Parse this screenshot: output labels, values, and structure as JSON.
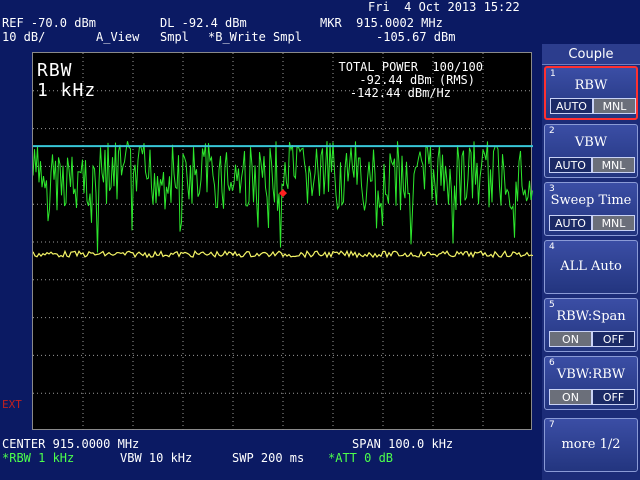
{
  "status_bar": {
    "datetime": "Fri  4 Oct 2013 15:22"
  },
  "header": {
    "ref": "REF -70.0 dBm",
    "dl": "DL -92.4 dBm",
    "mkr": "MKR  915.0002 MHz",
    "scale": "10 dB/",
    "a_view": "A_View",
    "smpl1": "Smpl",
    "b_write": "*B_Write Smpl",
    "mkr_level": "-105.67 dBm"
  },
  "display": {
    "rbw_label": "RBW",
    "rbw_value": "1 kHz",
    "total_power_title": "TOTAL POWER  100/100",
    "total_power_rms": "-92.44 dBm (RMS)",
    "total_power_density": "-142.44 dBm/Hz",
    "ext": "EXT",
    "display_line_div": 2.2,
    "trace_a_level_div": 3.1,
    "trace_b_level_div": 2.2,
    "marker_level_div": 3.6,
    "colors": {
      "trace_a": "#f4f466",
      "trace_b": "#2de62d",
      "display_line": "#38c7d8",
      "marker": "#ff2020",
      "grid": "#9a9a9a"
    }
  },
  "footer": {
    "center": "CENTER 915.0000 MHz",
    "span": "SPAN 100.0 kHz",
    "rbw": "*RBW 1 kHz",
    "vbw": "VBW 10 kHz",
    "swp": "SWP 200 ms",
    "att": "*ATT 0 dB"
  },
  "menu": {
    "title": "Couple",
    "keys": [
      {
        "num": "1",
        "label": "RBW",
        "on": "AUTO",
        "off": "MNL"
      },
      {
        "num": "2",
        "label": "VBW",
        "on": "AUTO",
        "off": "MNL"
      },
      {
        "num": "3",
        "label": "Sweep Time",
        "on": "AUTO",
        "off": "MNL"
      },
      {
        "num": "4",
        "label": "ALL Auto"
      },
      {
        "num": "5",
        "label": "RBW:Span",
        "on": "ON",
        "off": "OFF"
      },
      {
        "num": "6",
        "label": "VBW:RBW",
        "on": "ON",
        "off": "OFF"
      },
      {
        "num": "7",
        "label": "more 1/2"
      }
    ]
  }
}
